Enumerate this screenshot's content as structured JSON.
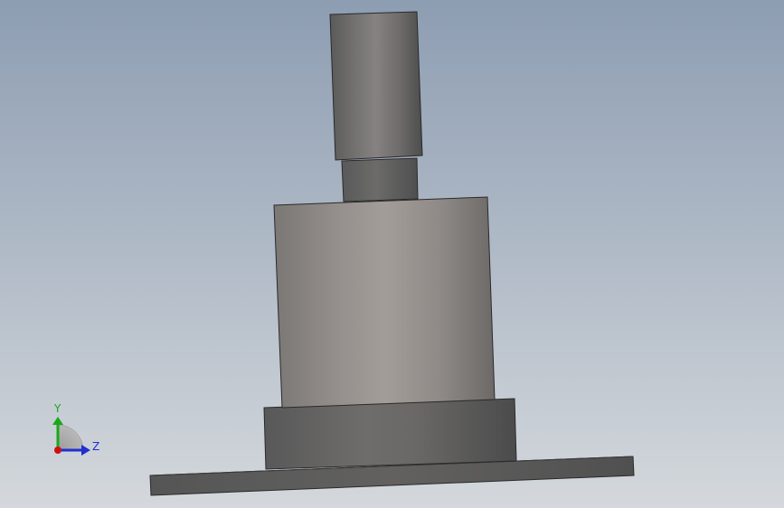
{
  "viewport": {
    "background_top": "#8d9db2",
    "background_bottom": "#d4d8dc"
  },
  "model": {
    "parts": [
      "top-shaft",
      "neck",
      "main-cylinder",
      "base-ring",
      "flange-plate"
    ],
    "shading": {
      "dark": "#505050",
      "mid": "#6e6e6e",
      "light": "#8f8b89",
      "highlight": "#a49e9a",
      "edge": "#2a2a2a"
    }
  },
  "triad": {
    "y_label": "Y",
    "z_label": "Z",
    "y_color": "#1aa81a",
    "z_color": "#1f2fd0",
    "x_color": "#cc1111"
  }
}
